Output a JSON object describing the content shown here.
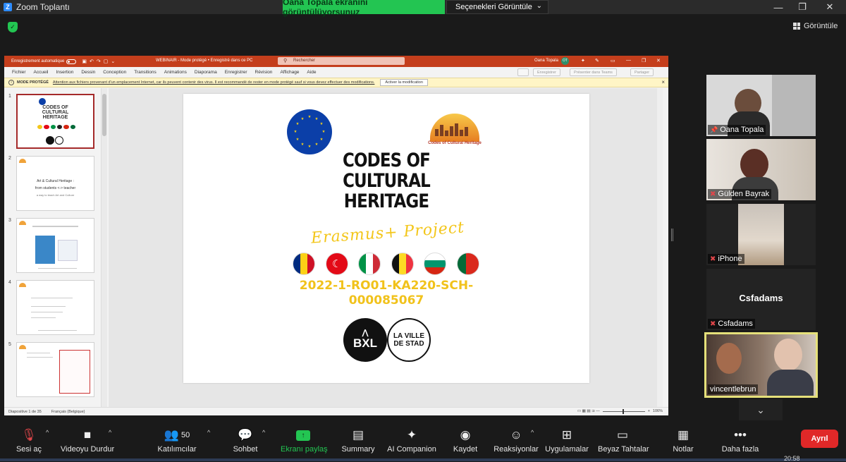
{
  "zoom": {
    "window_title": "Zoom Toplantı",
    "share_notice": "Oana Topala ekranını görüntülüyorsunuz",
    "view_options": "Seçenekleri Görüntüle",
    "view_button": "Görüntüle",
    "accent_green": "#23c552",
    "leave_red": "#e02828"
  },
  "ppt": {
    "autosave_label": "Enregistrement automatique",
    "doc_title": "WEBINAIR - Mode protégé • Enregistré dans ce PC",
    "search_placeholder": "Rechercher",
    "user_name": "Oana Topala",
    "user_initials": "OT",
    "menu": [
      "Fichier",
      "Accueil",
      "Insertion",
      "Dessin",
      "Conception",
      "Transitions",
      "Animations",
      "Diaporama",
      "Enregistrer",
      "Révision",
      "Affichage",
      "Aide"
    ],
    "ribbon_buttons": [
      "Enregistrer",
      "Présenter dans Teams",
      "Partager"
    ],
    "warning_label": "MODE PROTÉGÉ",
    "warning_message": "Attention aux fichiers provenant d'un emplacement Internet, car ils peuvent contenir des virus. Il est recommandé de rester en mode protégé sauf si vous devez effectuer des modifications.",
    "warning_action": "Activer la modification",
    "thumbnails": [
      {
        "num": "1"
      },
      {
        "num": "2",
        "lines": [
          "Art & Cultural Heritage :",
          "from students <-> teacher",
          "a way to teach Art and Culture"
        ]
      },
      {
        "num": "3"
      },
      {
        "num": "4"
      },
      {
        "num": "5"
      }
    ],
    "slide": {
      "title_lines": [
        "CODES OF",
        "CULTURAL",
        "HERITAGE"
      ],
      "subtitle": "Erasmus+ Project",
      "project_code_lines": [
        "2022-1-RO01-KA220-SCH-",
        "000085067"
      ],
      "partner_logo_caption": "Codes of Cultural Heritage",
      "bxl_label": "BXL",
      "ville_label_lines": [
        "LA VILLE",
        "DE STAD"
      ]
    },
    "status_slide": "Diapositive 1 de 35",
    "status_language": "Français (Belgique)",
    "status_zoom": "106%"
  },
  "participants": [
    {
      "name": "Oana Topala",
      "muted": false,
      "pinned": true
    },
    {
      "name": "Gülden Bayrak",
      "muted": true
    },
    {
      "name": "iPhone",
      "muted": true
    },
    {
      "name": "Csfadams",
      "muted": true,
      "display": "Csfadams"
    },
    {
      "name": "vincentlebrun",
      "muted": false,
      "active": true
    }
  ],
  "toolbar": {
    "audio": "Sesi aç",
    "video": "Videoyu Durdur",
    "participants": "Katılımcılar",
    "participants_count": "50",
    "chat": "Sohbet",
    "share": "Ekranı paylaş",
    "summary": "Summary",
    "companion": "AI Companion",
    "record": "Kaydet",
    "reactions": "Reaksiyonlar",
    "apps": "Uygulamalar",
    "whiteboard": "Beyaz Tahtalar",
    "notes": "Notlar",
    "more": "Daha fazla",
    "leave": "Ayrıl"
  },
  "clock": "20:58"
}
